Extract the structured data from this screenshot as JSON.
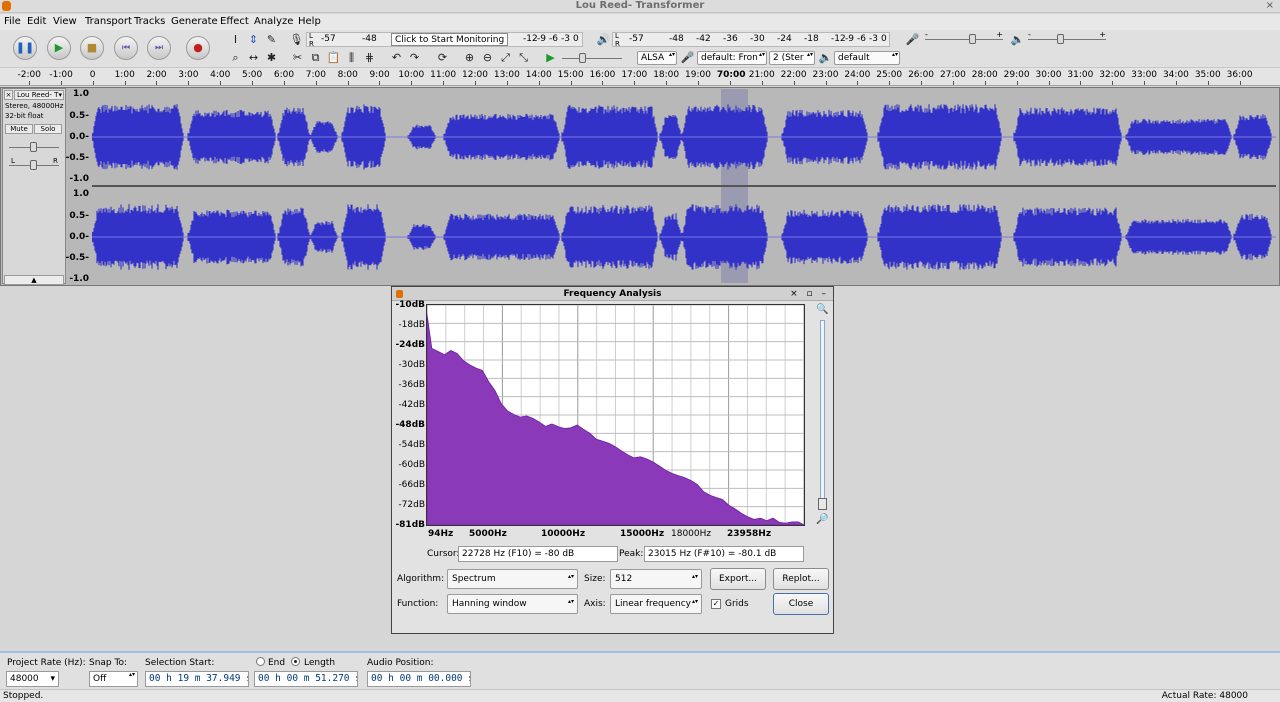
{
  "window": {
    "title": "Lou Reed- Transformer"
  },
  "menu": [
    "File",
    "Edit",
    "View",
    "Transport",
    "Tracks",
    "Generate",
    "Effect",
    "Analyze",
    "Help"
  ],
  "toolbar": {
    "transport_icons": [
      "pause-icon",
      "play-icon",
      "stop-icon",
      "skip-to-start-icon",
      "skip-to-end-icon",
      "record-icon"
    ],
    "record_meter": {
      "ticks": [
        "-57",
        "-48"
      ],
      "prompt": "Click to Start Monitoring",
      "ticks_right": [
        "-12",
        "-9",
        "-6",
        "-3",
        "0"
      ],
      "ch": [
        "L",
        "R"
      ]
    },
    "play_meter": {
      "ticks": [
        "-57",
        "-48",
        "-42",
        "-36",
        "-30",
        "-24",
        "-18",
        "-12",
        "-9",
        "-6",
        "-3",
        "0"
      ],
      "ch": [
        "L",
        "R"
      ]
    },
    "host": "ALSA",
    "record_device": "default: Fron",
    "channels": "2 (Ster",
    "playback_device": "default",
    "mixer_markers": [
      "-",
      "+",
      "-",
      "+"
    ]
  },
  "ruler": {
    "ticks": [
      "-2:00",
      "-1:00",
      "0",
      "1:00",
      "2:00",
      "3:00",
      "4:00",
      "5:00",
      "6:00",
      "7:00",
      "8:00",
      "9:00",
      "10:00",
      "11:00",
      "12:00",
      "13:00",
      "14:00",
      "15:00",
      "16:00",
      "17:00",
      "18:00",
      "19:00",
      "70:00",
      "21:00",
      "22:00",
      "23:00",
      "24:00",
      "25:00",
      "26:00",
      "27:00",
      "28:00",
      "29:00",
      "30:00",
      "31:00",
      "32:00",
      "33:00",
      "34:00",
      "35:00",
      "36:00"
    ]
  },
  "track": {
    "name": "Lou Reed- T",
    "info1": "Stereo, 48000Hz",
    "info2": "32-bit float",
    "mute": "Mute",
    "solo": "Solo",
    "gain_l": "L",
    "gain_r": "R",
    "scale": [
      "1.0",
      "0.5-",
      "0.0-",
      "-0.5-",
      "-1.0"
    ],
    "scale2": [
      "1.0",
      "0.5-",
      "0.0-",
      "-0.5-",
      "-1.0"
    ],
    "waveform_color": "#3232c8",
    "selection_color": "#9a9ab0"
  },
  "dialog": {
    "title": "Frequency Analysis",
    "window_controls": "× ▫ –",
    "y_labels": [
      "-10dB",
      "-18dB",
      "-24dB",
      "-30dB",
      "-36dB",
      "-42dB",
      "-48dB",
      "-54dB",
      "-60dB",
      "-66dB",
      "-72dB",
      "-81dB"
    ],
    "x_labels": [
      "94Hz",
      "5000Hz",
      "10000Hz",
      "15000Hz",
      "18000Hz",
      "23958Hz"
    ],
    "cursor_label": "Cursor:",
    "cursor_value": "22728 Hz (F10) = -80 dB",
    "peak_label": "Peak:",
    "peak_value": "23015 Hz (F#10) = -80.1 dB",
    "algorithm_label": "Algorithm:",
    "algorithm_value": "Spectrum",
    "size_label": "Size:",
    "size_value": "512",
    "export_label": "Export...",
    "replot_label": "Replot...",
    "function_label": "Function:",
    "function_value": "Hanning window",
    "axis_label": "Axis:",
    "axis_value": "Linear frequency",
    "grids_label": "Grids",
    "grids_checked": true,
    "close_label": "Close",
    "spectrum_color": "#8a3ab9"
  },
  "chart_data": {
    "type": "area",
    "title": "",
    "xlabel": "",
    "ylabel": "",
    "xlim": [
      94,
      23958
    ],
    "ylim": [
      -81,
      -10
    ],
    "x": [
      94,
      400,
      800,
      1200,
      1600,
      2000,
      2400,
      2800,
      3200,
      3600,
      4000,
      4400,
      4800,
      5200,
      5600,
      6000,
      6400,
      6800,
      7200,
      7600,
      8000,
      8400,
      8800,
      9200,
      9600,
      10000,
      10400,
      10800,
      11200,
      11600,
      12000,
      12400,
      12800,
      13200,
      13600,
      14000,
      14400,
      14800,
      15200,
      15600,
      16000,
      16400,
      16800,
      17200,
      17600,
      18000,
      18400,
      18800,
      19200,
      19600,
      20000,
      20400,
      20800,
      21200,
      21600,
      22000,
      22400,
      22800,
      23200,
      23600,
      23958
    ],
    "series": [
      {
        "values": [
          -13,
          -24,
          -25,
          -26,
          -25,
          -26,
          -28,
          -29,
          -30,
          -31,
          -35,
          -38,
          -42,
          -44,
          -45,
          -46,
          -46,
          -47,
          -48,
          -49,
          -48,
          -49,
          -50,
          -50,
          -49,
          -50,
          -51,
          -53,
          -54,
          -55,
          -56,
          -57,
          -58,
          -59,
          -59,
          -60,
          -61,
          -62,
          -63,
          -64,
          -65,
          -66,
          -67,
          -68,
          -70,
          -71,
          -72,
          -73,
          -75,
          -76,
          -77,
          -78,
          -79,
          -79,
          -80,
          -79,
          -80,
          -80,
          -80,
          -80,
          -81
        ]
      }
    ],
    "grid": true
  },
  "selection_toolbar": {
    "project_rate_label": "Project Rate (Hz):",
    "project_rate": "48000",
    "snap_label": "Snap To:",
    "snap_value": "Off",
    "selection_start_label": "Selection Start:",
    "selection_start": "00 h 19 m 37.949 s",
    "end_label": "End",
    "length_label": "Length",
    "length_value": "00 h 00 m 51.270 s",
    "audio_position_label": "Audio Position:",
    "audio_position": "00 h 00 m 00.000 s"
  },
  "status": {
    "left": "Stopped.",
    "right": "Actual Rate: 48000"
  }
}
